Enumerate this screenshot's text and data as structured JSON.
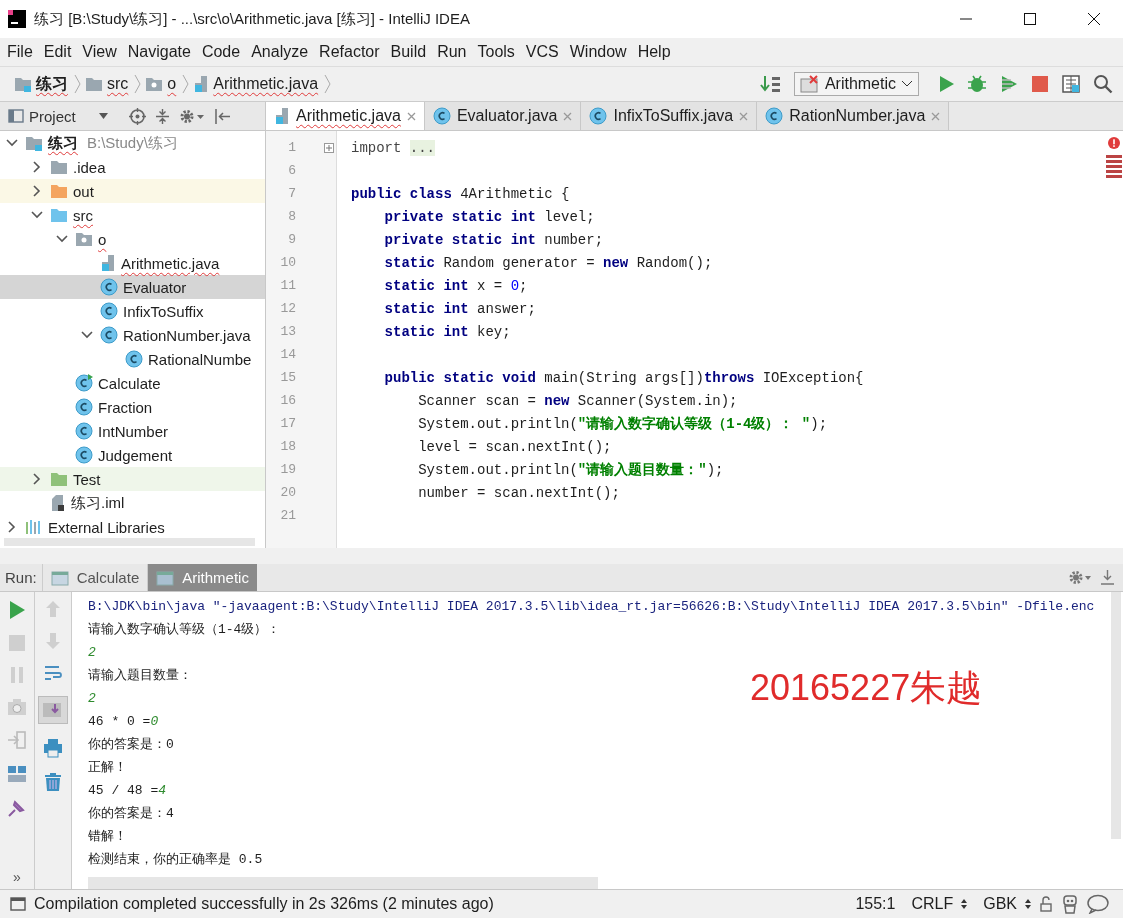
{
  "window": {
    "title": "练习 [B:\\Study\\练习] - ...\\src\\o\\Arithmetic.java [练习] - IntelliJ IDEA"
  },
  "menu": [
    "File",
    "Edit",
    "View",
    "Navigate",
    "Code",
    "Analyze",
    "Refactor",
    "Build",
    "Run",
    "Tools",
    "VCS",
    "Window",
    "Help"
  ],
  "breadcrumbs": [
    {
      "label": "练习",
      "kind": "module",
      "error": true
    },
    {
      "label": "src",
      "kind": "folder",
      "error": true
    },
    {
      "label": "o",
      "kind": "package",
      "error": true
    },
    {
      "label": "Arithmetic.java",
      "kind": "java-file",
      "error": true
    }
  ],
  "run_configuration": {
    "label": "Arithmetic"
  },
  "project_panel": {
    "title": "Project",
    "tree": [
      {
        "label": "练习",
        "path": "B:\\Study\\练习",
        "kind": "module",
        "expanded": true,
        "selected": false,
        "error": true,
        "children": [
          {
            "label": ".idea",
            "kind": "folder",
            "expanded": false,
            "selected": false,
            "error": false
          },
          {
            "label": "out",
            "kind": "excluded-folder",
            "expanded": false,
            "selected": false,
            "error": false
          },
          {
            "label": "src",
            "kind": "source-folder",
            "expanded": true,
            "selected": false,
            "error": true,
            "children": [
              {
                "label": "o",
                "kind": "package",
                "expanded": true,
                "selected": false,
                "error": true,
                "children": [
                  {
                    "label": "Arithmetic.java",
                    "kind": "java-file",
                    "expanded": false,
                    "selected": false,
                    "error": true
                  },
                  {
                    "label": "Evaluator",
                    "kind": "class",
                    "expanded": false,
                    "selected": true,
                    "error": false
                  },
                  {
                    "label": "InfixToSuffix",
                    "kind": "class",
                    "expanded": false,
                    "selected": false,
                    "error": false
                  },
                  {
                    "label": "RationNumber.java",
                    "kind": "class",
                    "expanded": true,
                    "selected": false,
                    "error": false,
                    "children": [
                      {
                        "label": "RationalNumbe",
                        "kind": "class",
                        "expanded": false,
                        "selected": false,
                        "error": false
                      }
                    ]
                  }
                ]
              },
              {
                "label": "Calculate",
                "kind": "runnable-class",
                "expanded": false,
                "selected": false,
                "error": false
              },
              {
                "label": "Fraction",
                "kind": "class",
                "expanded": false,
                "selected": false,
                "error": false
              },
              {
                "label": "IntNumber",
                "kind": "class",
                "expanded": false,
                "selected": false,
                "error": false
              },
              {
                "label": "Judgement",
                "kind": "class",
                "expanded": false,
                "selected": false,
                "error": false
              }
            ]
          },
          {
            "label": "Test",
            "kind": "test-folder",
            "expanded": false,
            "selected": false,
            "error": false
          },
          {
            "label": "练习.iml",
            "kind": "iml",
            "expanded": false,
            "selected": false,
            "error": false
          }
        ]
      },
      {
        "label": "External Libraries",
        "kind": "libraries",
        "expanded": false,
        "selected": false,
        "error": false
      }
    ]
  },
  "editor_tabs": [
    {
      "label": "Arithmetic.java",
      "kind": "java-file",
      "selected": true,
      "error": true
    },
    {
      "label": "Evaluator.java",
      "kind": "class",
      "selected": false,
      "error": false
    },
    {
      "label": "InfixToSuffix.java",
      "kind": "class",
      "selected": false,
      "error": false
    },
    {
      "label": "RationNumber.java",
      "kind": "class",
      "selected": false,
      "error": false
    }
  ],
  "code_lines": [
    {
      "number": "1",
      "tokens": [
        {
          "text": "import ",
          "kind": "folded"
        },
        {
          "text": "...",
          "kind": "ellipsis"
        }
      ]
    },
    {
      "number": "6"
    },
    {
      "number": "7",
      "tokens": [
        {
          "text": "public class ",
          "kind": "keyword"
        },
        {
          "text": "4Arithmetic {",
          "kind": "plain"
        }
      ]
    },
    {
      "number": "8",
      "tokens": [
        {
          "text": "    private static int",
          "kind": "keyword"
        },
        {
          "text": " level;",
          "kind": "plain"
        }
      ]
    },
    {
      "number": "9",
      "tokens": [
        {
          "text": "    private static int",
          "kind": "keyword"
        },
        {
          "text": " number;",
          "kind": "plain"
        }
      ]
    },
    {
      "number": "10",
      "tokens": [
        {
          "text": "    static",
          "kind": "keyword"
        },
        {
          "text": " Random generator = ",
          "kind": "plain"
        },
        {
          "text": "new",
          "kind": "keyword"
        },
        {
          "text": " Random();",
          "kind": "plain"
        }
      ]
    },
    {
      "number": "11",
      "tokens": [
        {
          "text": "    static int",
          "kind": "keyword"
        },
        {
          "text": " x = ",
          "kind": "plain"
        },
        {
          "text": "0",
          "kind": "number"
        },
        {
          "text": ";",
          "kind": "plain"
        }
      ]
    },
    {
      "number": "12",
      "tokens": [
        {
          "text": "    static int",
          "kind": "keyword"
        },
        {
          "text": " answer;",
          "kind": "plain"
        }
      ]
    },
    {
      "number": "13",
      "tokens": [
        {
          "text": "    static int",
          "kind": "keyword"
        },
        {
          "text": " key;",
          "kind": "plain"
        }
      ]
    },
    {
      "number": "14"
    },
    {
      "number": "15",
      "tokens": [
        {
          "text": "    public static void",
          "kind": "keyword"
        },
        {
          "text": " main(String args[])",
          "kind": "plain"
        },
        {
          "text": "throws",
          "kind": "keyword"
        },
        {
          "text": " IOException{",
          "kind": "plain"
        }
      ]
    },
    {
      "number": "16",
      "tokens": [
        {
          "text": "        Scanner scan = ",
          "kind": "plain"
        },
        {
          "text": "new",
          "kind": "keyword"
        },
        {
          "text": " Scanner(System.in);",
          "kind": "plain"
        }
      ]
    },
    {
      "number": "17",
      "tokens": [
        {
          "text": "        System.out.println(",
          "kind": "plain"
        },
        {
          "text": "\"请输入数字确认等级（1-4级）： \"",
          "kind": "string"
        },
        {
          "text": ");",
          "kind": "plain"
        }
      ]
    },
    {
      "number": "18",
      "tokens": [
        {
          "text": "        level = scan.nextInt();",
          "kind": "plain"
        }
      ]
    },
    {
      "number": "19",
      "tokens": [
        {
          "text": "        System.out.println(",
          "kind": "plain"
        },
        {
          "text": "\"请输入题目数量：\"",
          "kind": "string"
        },
        {
          "text": ");",
          "kind": "plain"
        }
      ]
    },
    {
      "number": "20",
      "tokens": [
        {
          "text": "        number = scan.nextInt();",
          "kind": "plain"
        }
      ]
    },
    {
      "number": "21"
    }
  ],
  "run_panel": {
    "label": "Run:",
    "tabs": [
      {
        "label": "Calculate",
        "selected": false
      },
      {
        "label": "Arithmetic",
        "selected": true
      }
    ],
    "console": [
      {
        "kind": "command",
        "text": "B:\\JDK\\bin\\java \"-javaagent:B:\\Study\\IntelliJ IDEA 2017.3.5\\lib\\idea_rt.jar=56626:B:\\Study\\IntelliJ IDEA 2017.3.5\\bin\" -Dfile.enc"
      },
      {
        "kind": "output",
        "text": "请输入数字确认等级（1-4级）："
      },
      {
        "kind": "input",
        "text": "2"
      },
      {
        "kind": "output",
        "text": "请输入题目数量："
      },
      {
        "kind": "input",
        "text": "2"
      },
      {
        "kind": "output",
        "text": "46 * 0 =",
        "answer": "0"
      },
      {
        "kind": "output",
        "text": "你的答案是：0"
      },
      {
        "kind": "output",
        "text": "正解！"
      },
      {
        "kind": "output",
        "text": "45 / 48 =",
        "answer": "4"
      },
      {
        "kind": "output",
        "text": "你的答案是：4"
      },
      {
        "kind": "output",
        "text": "错解！"
      },
      {
        "kind": "output",
        "text": "检测结束，你的正确率是 0.5"
      }
    ],
    "more": "»"
  },
  "annotation": "20165227朱越",
  "status_bar": {
    "message": "Compilation completed successfully in 2s 326ms (2 minutes ago)",
    "position": "155:1",
    "line_separator": "CRLF",
    "encoding": "GBK"
  }
}
